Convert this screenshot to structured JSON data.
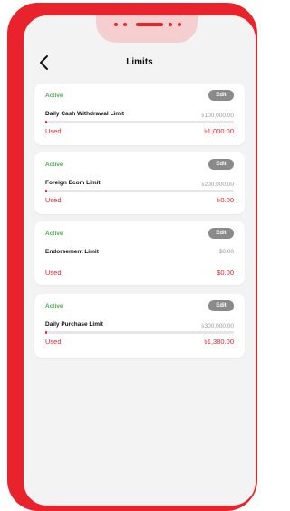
{
  "header": {
    "title": "Limits"
  },
  "limits": [
    {
      "status": "Active",
      "edit_label": "Edit",
      "name": "Daily Cash Withdrawal Limit",
      "limit": "৳100,000.00",
      "used_label": "Used",
      "used": "৳1,000.00",
      "used_fraction": 0.01
    },
    {
      "status": "Active",
      "edit_label": "Edit",
      "name": "Foreign Ecom Limit",
      "limit": "৳200,000.00",
      "used_label": "Used",
      "used": "৳0.00",
      "used_fraction": 0
    },
    {
      "status": "Active",
      "edit_label": "Edit",
      "name": "Endorsement Limit",
      "limit": "$0.00",
      "used_label": "Used",
      "used": "$0.00",
      "used_fraction": 0
    },
    {
      "status": "Active",
      "edit_label": "Edit",
      "name": "Daily Purchase Limit",
      "limit": "৳300,000.00",
      "used_label": "Used",
      "used": "৳1,380.00",
      "used_fraction": 0.0046
    }
  ],
  "colors": {
    "frame": "#e8232b",
    "active": "#4caf50",
    "used": "#e8232b",
    "edit_button": "#8a8a8a"
  },
  "icons": {
    "back": "chevron-left-icon"
  }
}
